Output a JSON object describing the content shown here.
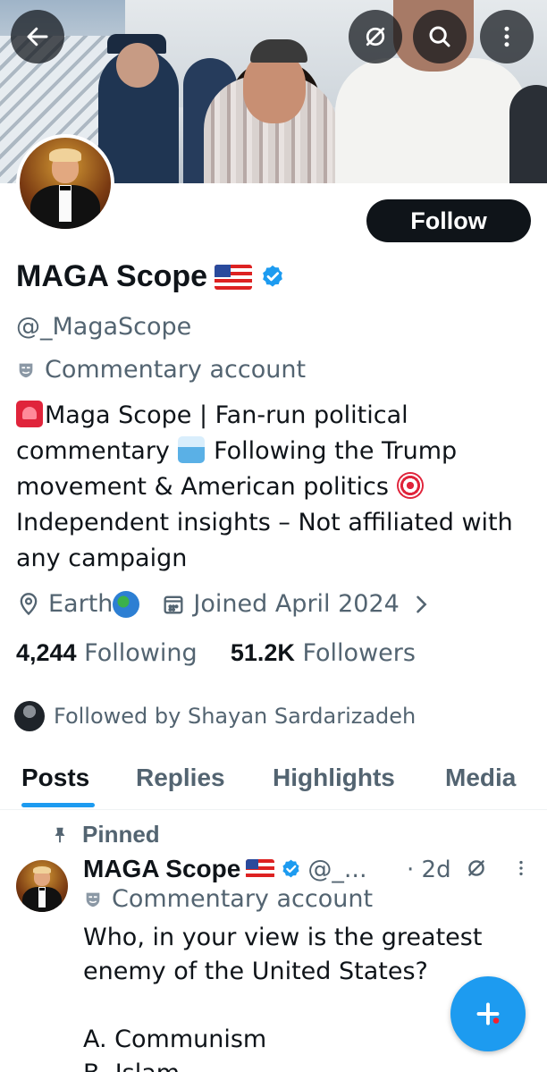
{
  "header": {
    "back_icon": "arrow-left-icon",
    "grok_icon": "grok-slash-icon",
    "search_icon": "search-icon",
    "more_icon": "more-vertical-icon"
  },
  "profile": {
    "follow_label": "Follow",
    "display_name": "MAGA Scope",
    "name_emoji": "us-flag",
    "handle": "@_MagaScope",
    "account_label": "Commentary account",
    "bio_line1": "Maga Scope | Fan-run political",
    "bio_line2a": "commentary",
    "bio_line2b": "Following the Trump",
    "bio_line3": "movement & American politics",
    "bio_line4": "Independent insights – Not affiliated with",
    "bio_line5": "any campaign",
    "location": "Earth",
    "joined": "Joined April 2024",
    "following_count": "4,244",
    "following_label": "Following",
    "followers_count": "51.2K",
    "followers_label": "Followers",
    "followed_by": "Followed by Shayan Sardarizadeh"
  },
  "tabs": [
    {
      "label": "Posts"
    },
    {
      "label": "Replies"
    },
    {
      "label": "Highlights"
    },
    {
      "label": "Media"
    }
  ],
  "post": {
    "pinned_label": "Pinned",
    "name": "MAGA Scope",
    "handle": "@_...",
    "time": "· 2d",
    "account_label": "Commentary account",
    "text": "Who, in your view is the greatest\nenemy of the United States?\n\nA. Communism\nB. Islam"
  },
  "colors": {
    "accent": "#1d9bf0",
    "text": "#0f1419",
    "muted": "#536471"
  }
}
